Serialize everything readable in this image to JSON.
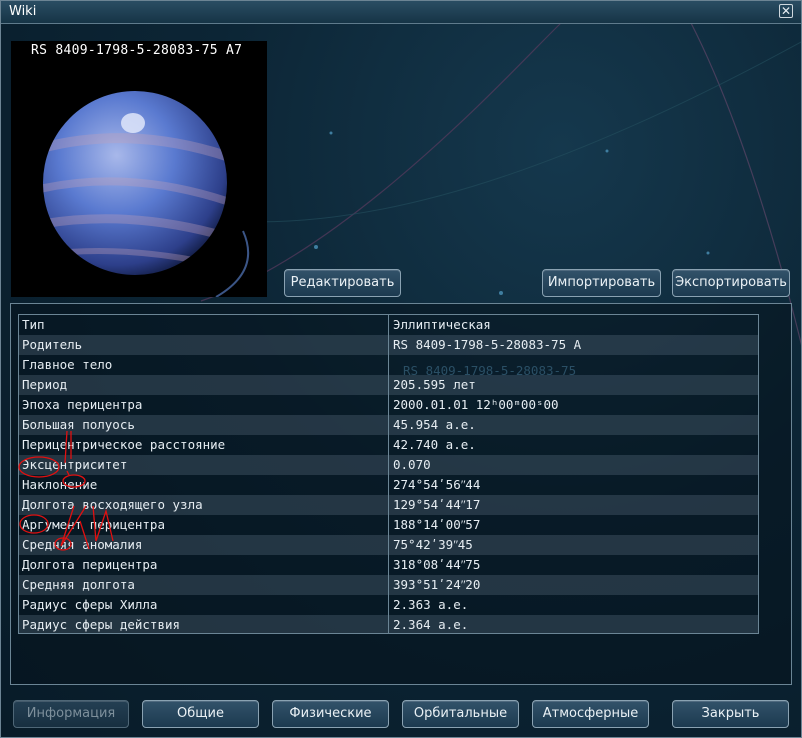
{
  "window": {
    "title": "Wiki"
  },
  "object": {
    "name": "RS 8409-1798-5-28083-75 A7"
  },
  "top_buttons": {
    "edit": "Редактировать",
    "import": "Импортировать",
    "export": "Экспортировать"
  },
  "orbit_table": {
    "rows": [
      {
        "label": "Тип",
        "value": "Эллиптическая"
      },
      {
        "label": "Родитель",
        "value": "RS 8409-1798-5-28083-75 A"
      },
      {
        "label": "Главное тело",
        "value": ""
      },
      {
        "label": "Период",
        "value": "205.595 лет"
      },
      {
        "label": "Эпоха перицентра",
        "value": "2000.01.01 12ʰ00ᵐ00ˢ00"
      },
      {
        "label": "Большая полуось",
        "value": "45.954 а.е."
      },
      {
        "label": "Перицентрическое расстояние",
        "value": "42.740 а.е."
      },
      {
        "label": "Эксцентриситет",
        "value": "0.070"
      },
      {
        "label": "Наклонение",
        "value": "274°54ʹ56ʺ44"
      },
      {
        "label": "Долгота восходящего узла",
        "value": "129°54ʹ44ʺ17"
      },
      {
        "label": "Аргумент перицентра",
        "value": "188°14ʹ00ʺ57"
      },
      {
        "label": "Средняя аномалия",
        "value": "75°42ʹ39ʺ45"
      },
      {
        "label": "Долгота перицентра",
        "value": "318°08ʹ44ʺ75"
      },
      {
        "label": "Средняя долгота",
        "value": "393°51ʹ24ʺ20"
      },
      {
        "label": "Радиус сферы Хилла",
        "value": "2.363 а.е."
      },
      {
        "label": "Радиус сферы действия",
        "value": "2.364 а.е."
      }
    ],
    "ghost_text": "RS 8409-1798-5-28083-75"
  },
  "bottom_tabs": {
    "info": "Информация",
    "general": "Общие",
    "physical": "Физические",
    "orbital": "Орбитальные",
    "atmospheric": "Атмосферные",
    "close": "Закрыть"
  },
  "colors": {
    "panel_bg": "#0b2233",
    "button_border": "#8aa2b2",
    "planet_main": "#4f6fc8"
  }
}
